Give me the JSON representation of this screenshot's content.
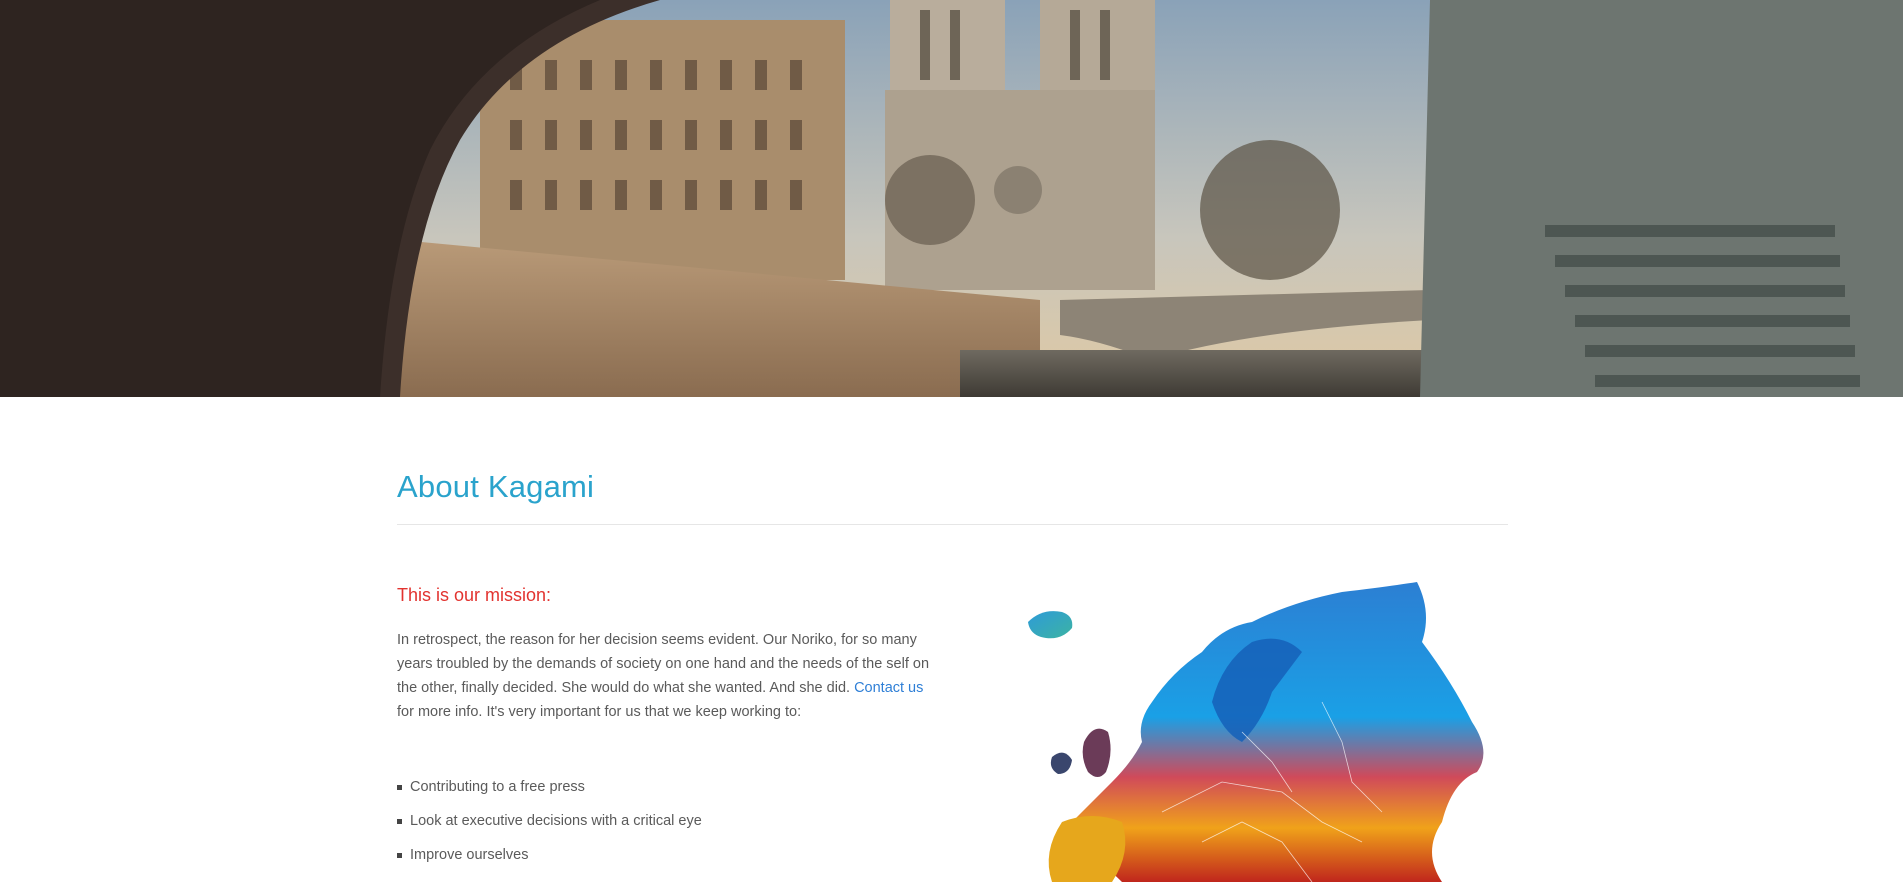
{
  "hero": {
    "image_name": "paris-notre-dame-bridge-photo"
  },
  "about": {
    "title": "About Kagami",
    "mission_heading": "This is our mission:",
    "paragraph_before_link": "In retrospect, the reason for her decision seems evident. Our Noriko, for so many years troubled by the demands of society on one hand and the needs of the self on the other, finally decided. She would do what she wanted. And she did. ",
    "link_text": "Contact us",
    "paragraph_after_link": " for more info. It's very important for us that we keep working to:",
    "goals": [
      "Contributing to a free press",
      "Look at executive decisions with a critical eye",
      "Improve ourselves"
    ],
    "map_image_name": "europe-colorful-map"
  },
  "colors": {
    "title": "#2aa3cc",
    "mission_heading": "#e2332f",
    "link": "#2f7fd6",
    "text": "#5a5a5a"
  }
}
